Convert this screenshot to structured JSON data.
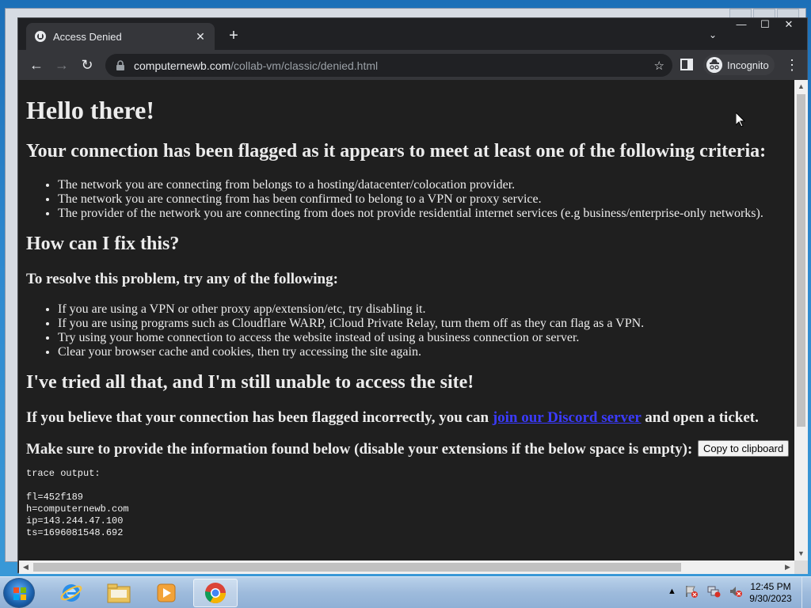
{
  "browser": {
    "tab_title": "Access Denied",
    "tab_close": "✕",
    "new_tab": "+",
    "tab_search": "⌄",
    "window_buttons": {
      "minimize": "—",
      "maximize": "☐",
      "close": "✕"
    },
    "url_domain": "computernewb.com",
    "url_path": "/collab-vm/classic/denied.html",
    "incognito_label": "Incognito",
    "back": "←",
    "forward": "→",
    "reload": "↻",
    "star": "☆",
    "menu": "⋮"
  },
  "page": {
    "heading": "Hello there!",
    "criteria_heading": "Your connection has been flagged as it appears to meet at least one of the following criteria:",
    "criteria": [
      "The network you are connecting from belongs to a hosting/datacenter/colocation provider.",
      "The network you are connecting from has been confirmed to belong to a VPN or proxy service.",
      "The provider of the network you are connecting from does not provide residential internet services (e.g business/enterprise-only networks)."
    ],
    "fix_heading": "How can I fix this?",
    "resolve_heading": "To resolve this problem, try any of the following:",
    "fixes": [
      "If you are using a VPN or other proxy app/extension/etc, try disabling it.",
      "If you are using programs such as Cloudflare WARP, iCloud Private Relay, turn them off as they can flag as a VPN.",
      "Try using your home connection to access the website instead of using a business connection or server.",
      "Clear your browser cache and cookies, then try accessing the site again."
    ],
    "still_heading": "I've tried all that, and I'm still unable to access the site!",
    "incorrect_prefix": "If you believe that your connection has been flagged incorrectly, you can ",
    "discord_link": "join our Discord server",
    "incorrect_suffix": " and open a ticket.",
    "info_text": "Make sure to provide the information found below (disable your extensions if the below space is empty):",
    "copy_button": "Copy to clipboard",
    "trace_label": "trace output:",
    "trace_lines": [
      "fl=452f189",
      "h=computernewb.com",
      "ip=143.244.47.100",
      "ts=1696081548.692"
    ]
  },
  "taskbar": {
    "time": "12:45 PM",
    "date": "9/30/2023",
    "tray_arrow": "▲"
  },
  "colors": {
    "page_bg": "#1f1f1f",
    "link": "#3b3bff",
    "chrome_bg": "#202124",
    "toolbar_bg": "#35363a"
  }
}
